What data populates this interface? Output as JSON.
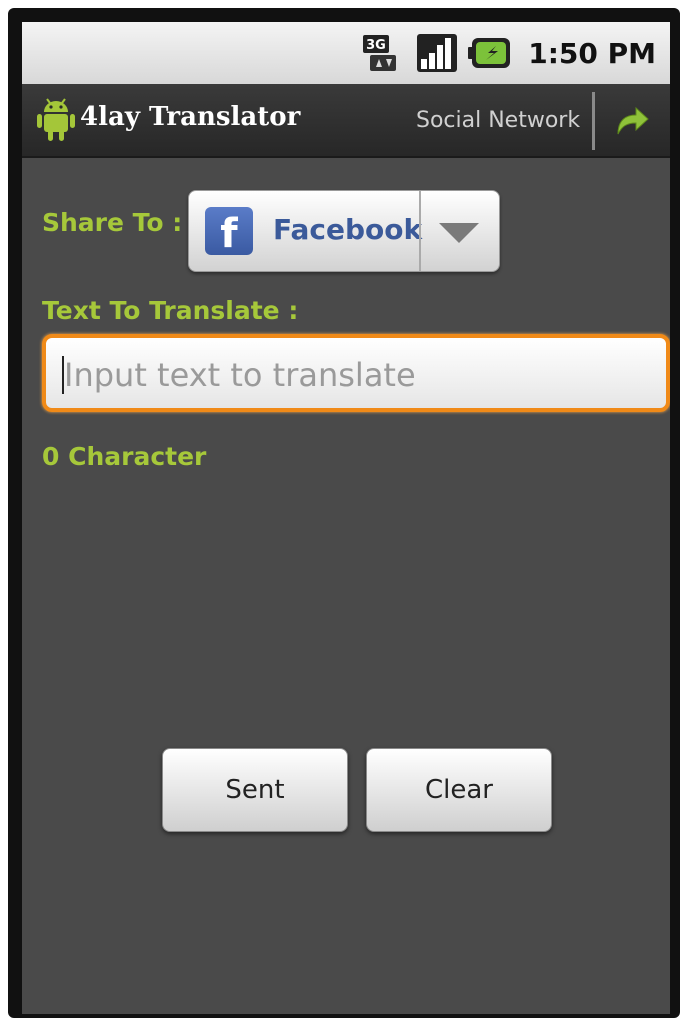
{
  "status_bar": {
    "network": "3G",
    "time": "1:50 PM"
  },
  "title_bar": {
    "app_title": "4lay Translator",
    "section_label": "Social Network",
    "icons": [
      "android-logo-icon",
      "share-arrow-icon"
    ]
  },
  "form": {
    "share_label": "Share To :",
    "share_selected": "Facebook",
    "text_label": "Text To Translate :",
    "text_value": "",
    "text_placeholder": "Input text to translate",
    "char_count": "0 Character"
  },
  "buttons": {
    "sent": "Sent",
    "clear": "Clear"
  },
  "colors": {
    "accent_green": "#a6c83a",
    "focus_orange": "#f08a18",
    "facebook_blue": "#3b5a9a"
  }
}
